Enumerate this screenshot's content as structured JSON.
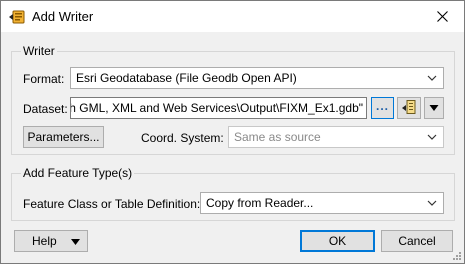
{
  "window": {
    "title": "Add Writer"
  },
  "writer_group": {
    "title": "Writer",
    "format_label": "Format:",
    "format_value": "Esri Geodatabase (File Geodb Open API)",
    "dataset_label": "Dataset:",
    "dataset_value": "th GML, XML and Web Services\\Output\\FIXM_Ex1.gdb\"",
    "browse_label": "...",
    "parameters_label": "Parameters...",
    "coord_label": "Coord. System:",
    "coord_placeholder": "Same as source"
  },
  "feature_group": {
    "title": "Add Feature Type(s)",
    "definition_label": "Feature Class or Table Definition:",
    "definition_value": "Copy from Reader..."
  },
  "footer": {
    "help_label": "Help",
    "ok_label": "OK",
    "cancel_label": "Cancel"
  },
  "icons": {
    "app": "fme-writer-icon",
    "close": "close-icon",
    "dropdown": "chevron-down-icon",
    "dataset_options": "file-options-icon",
    "menu_arrow": "triangle-down-icon"
  },
  "colors": {
    "accent": "#0078d7",
    "dots": "#1e5fa8"
  }
}
